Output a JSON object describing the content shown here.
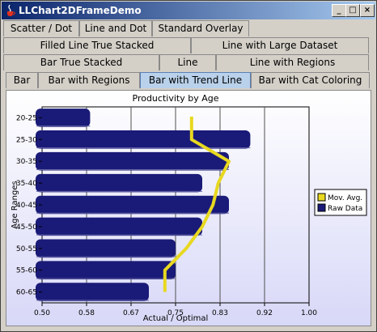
{
  "window": {
    "title": "LLChart2DFrameDemo",
    "minimize_icon": "minimize-icon",
    "maximize_icon": "maximize-icon",
    "close_icon": "close-icon"
  },
  "tabs": {
    "row1": [
      "Scatter / Dot",
      "Line and Dot",
      "Standard Overlay"
    ],
    "row2": [
      "Filled Line True Stacked",
      "Line with Large Dataset"
    ],
    "row3": [
      "Bar True Stacked",
      "Line",
      "Line with Regions"
    ],
    "row4": [
      "Bar",
      "Bar with Regions",
      "Bar with Trend Line",
      "Bar with Cat Coloring"
    ],
    "selected": "Bar with Trend Line"
  },
  "chart_data": {
    "type": "bar",
    "orientation": "horizontal",
    "title": "Productivity by Age",
    "xlabel": "Actual / Optimal",
    "ylabel": "Age Ranges",
    "xlim": [
      0.5,
      1.0
    ],
    "x_ticks": [
      "0.50",
      "0.58",
      "0.67",
      "0.75",
      "0.83",
      "0.92",
      "1.00"
    ],
    "categories": [
      "20-25",
      "25-30",
      "30-35",
      "35-40",
      "40-45",
      "45-50",
      "50-55",
      "55-60",
      "60-65"
    ],
    "series": [
      {
        "name": "Raw Data",
        "type": "bar",
        "color": "#1a1a78",
        "values": [
          0.59,
          0.89,
          0.85,
          0.8,
          0.85,
          0.8,
          0.75,
          0.75,
          0.7
        ]
      },
      {
        "name": "Mov. Avg.",
        "type": "line",
        "color": "#e8d820",
        "values": [
          0.78,
          0.78,
          0.85,
          0.83,
          0.82,
          0.8,
          0.77,
          0.73,
          0.73
        ]
      }
    ],
    "legend": {
      "position": "right",
      "entries": [
        "Mov. Avg.",
        "Raw Data"
      ]
    },
    "grid": true
  }
}
